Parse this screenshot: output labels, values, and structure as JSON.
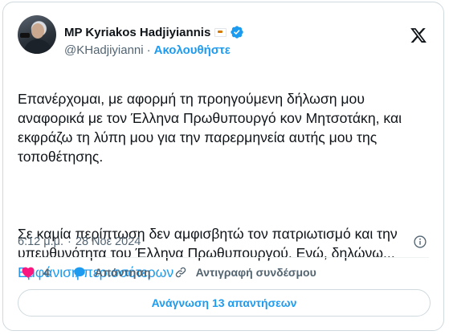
{
  "author": {
    "display_name": "MP Kyriakos Hadjiyiannis",
    "handle": "@KHadjiyianni",
    "separator": "·",
    "follow_label": "Ακολουθήστε",
    "flag_icon": "cyprus-flag-icon",
    "verified_icon": "verified-badge-icon",
    "verified_color": "#1d9bf0"
  },
  "tweet": {
    "paragraph_1": "Επανέρχομαι, με αφορμή τη προηγούμενη δήλωση μου αναφορικά με τον Έλληνα Πρωθυπουργό κον Μητσοτάκη, και εκφράζω τη λύπη μου για την παρερμηνεία αυτής μου της τοποθέτησης.",
    "paragraph_2": "Σε καμία περίπτωση δεν αμφισβητώ τον πατριωτισμό και την υπευθυνότητα του Έλληνα Πρωθυπουργού. Ενώ, δηλώνω...",
    "show_more_label": "Εμφάνιση περισσότερων"
  },
  "meta": {
    "time": "6:12 μ.μ.",
    "separator": "·",
    "date": "28 Νοε 2024"
  },
  "actions": {
    "like_count": "4",
    "reply_label": "Απάντηση",
    "copy_link_label": "Αντιγραφή συνδέσμου",
    "like_color": "#f91880"
  },
  "read_replies_label": "Ανάγνωση 13 απαντήσεων",
  "accent_color": "#1d9bf0"
}
